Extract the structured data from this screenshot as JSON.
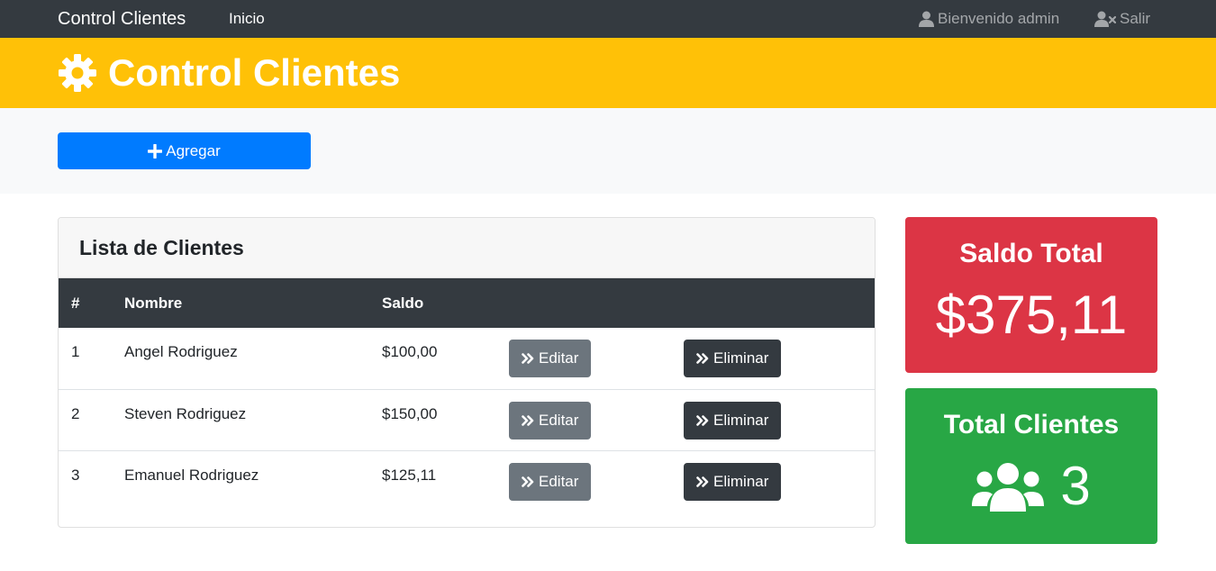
{
  "navbar": {
    "brand": "Control Clientes",
    "inicio": "Inicio",
    "user_label": "Bienvenido admin",
    "logout_label": "Salir"
  },
  "header": {
    "title": "Control Clientes",
    "icon": "gear-icon"
  },
  "actions": {
    "add_label": "Agregar"
  },
  "clients_card": {
    "title": "Lista de Clientes",
    "columns": [
      "#",
      "Nombre",
      "Saldo"
    ],
    "rows": [
      {
        "num": "1",
        "name": "Angel Rodriguez",
        "saldo": "$100,00"
      },
      {
        "num": "2",
        "name": "Steven Rodriguez",
        "saldo": "$150,00"
      },
      {
        "num": "3",
        "name": "Emanuel Rodriguez",
        "saldo": "$125,11"
      }
    ],
    "edit_label": "Editar",
    "delete_label": "Eliminar"
  },
  "stats": {
    "saldo_title": "Saldo Total",
    "saldo_value": "$375,11",
    "clientes_title": "Total Clientes",
    "clientes_value": "3"
  },
  "colors": {
    "navbar": "#343a40",
    "header": "#ffc107",
    "primary": "#007bff",
    "danger": "#dc3545",
    "success": "#28a745",
    "secondary": "#6c757d"
  }
}
